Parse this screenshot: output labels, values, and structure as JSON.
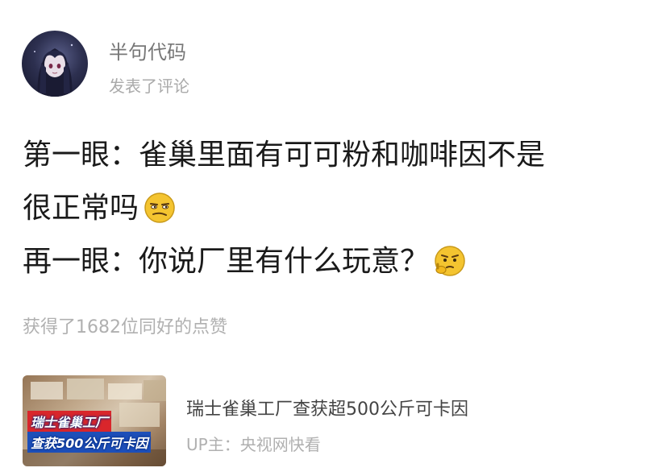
{
  "post": {
    "username": "半句代码",
    "action": "发表了评论",
    "avatar_icon": "anime-avatar"
  },
  "comment": {
    "line1": "第一眼：雀巢里面有可可粉和咖啡因不是",
    "line2": "很正常吗",
    "line2_emoji": "smirk-emoji",
    "line3": "再一眼：你说厂里有什么玩意？",
    "line3_emoji": "thinking-emoji"
  },
  "likes_text": "获得了1682位同好的点赞",
  "video_card": {
    "thumbnail_line1": "瑞士雀巢工厂",
    "thumbnail_line2": "查获500公斤可卡因",
    "title": "瑞士雀巢工厂查获超500公斤可卡因",
    "up_label": "UP主：央视网快看"
  },
  "colors": {
    "primary_text": "#1a1a1a",
    "secondary_text": "#777777",
    "muted_text": "#b0b0b0",
    "emoji_yellow": "#f4c430",
    "thumb_red": "#d9262b",
    "thumb_blue": "#1d4fb8"
  }
}
